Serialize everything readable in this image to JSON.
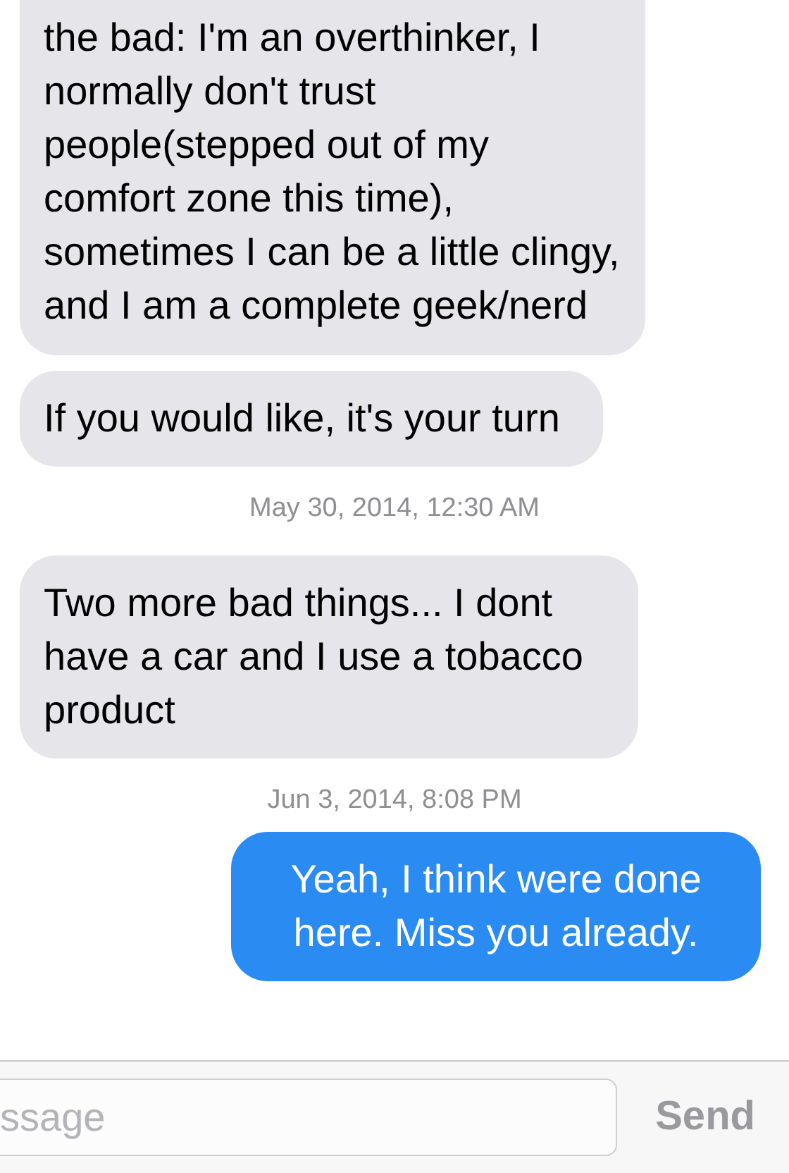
{
  "messages": [
    {
      "kind": "incoming",
      "text": "the bad: I'm an overthinker, I normally don't trust people(stepped out of my comfort zone this time), sometimes I can be a little clingy, and I am a complete geek/nerd"
    },
    {
      "kind": "incoming",
      "text": "If you would like, it's your turn"
    },
    {
      "kind": "timestamp",
      "text": "May 30, 2014, 12:30 AM"
    },
    {
      "kind": "incoming",
      "text": "Two more bad things... I dont have a car and I use a tobacco product"
    },
    {
      "kind": "timestamp",
      "text": "Jun 3, 2014, 8:08 PM"
    },
    {
      "kind": "outgoing",
      "text": "Yeah, I think were done here. Miss you already."
    }
  ],
  "composer": {
    "placeholder": "ssage",
    "send": {
      "label": "Send",
      "disabled": true
    }
  }
}
